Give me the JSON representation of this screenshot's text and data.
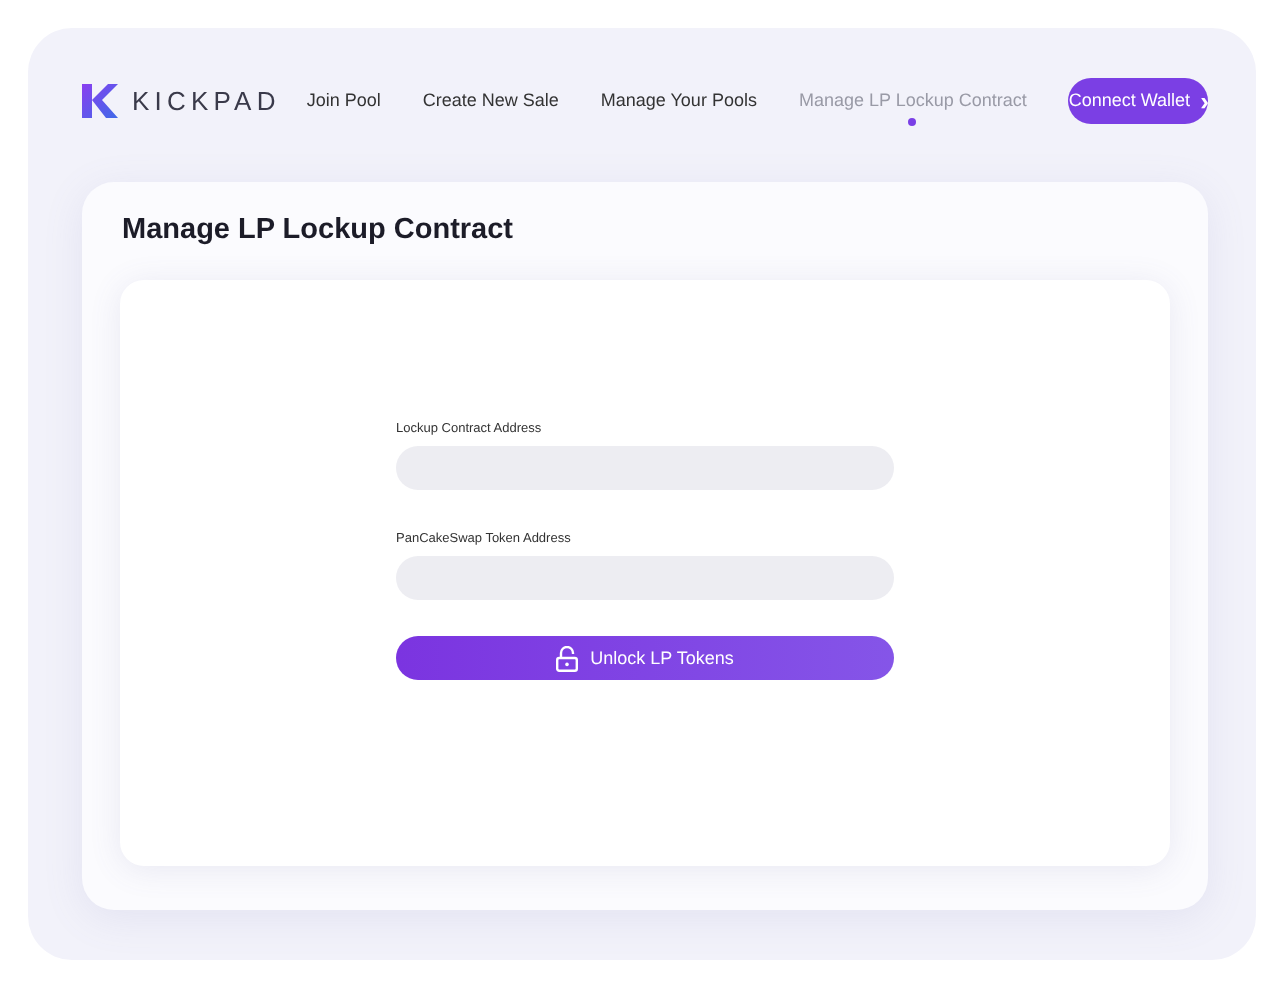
{
  "logo": {
    "text": "KICKPAD"
  },
  "nav": [
    {
      "label": "Join Pool",
      "selected": false
    },
    {
      "label": "Create New Sale",
      "selected": false
    },
    {
      "label": "Manage Your Pools",
      "selected": false
    },
    {
      "label": "Manage LP Lockup Contract",
      "selected": true
    }
  ],
  "connect_button": {
    "label": "Connect Wallet",
    "icon": "›"
  },
  "card": {
    "title": "Manage LP Lockup Contract",
    "fields": [
      {
        "label": "Lockup Contract Address"
      },
      {
        "label": "PanCakeSwap Token Address"
      }
    ],
    "submit": {
      "label": "Unlock LP Tokens"
    }
  }
}
